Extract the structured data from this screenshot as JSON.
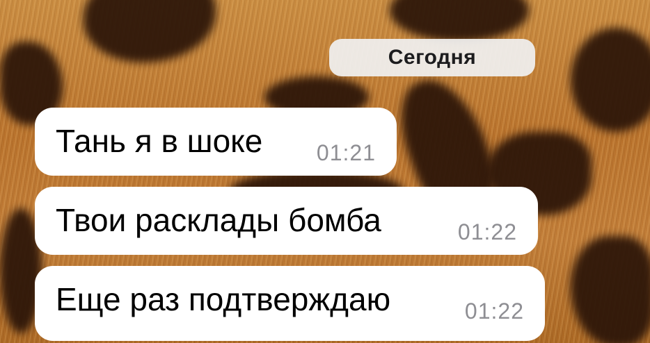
{
  "chat": {
    "date_separator": "Сегодня",
    "messages": [
      {
        "text": "Тань я в шоке",
        "time": "01:21"
      },
      {
        "text": "Твои расклады бомба",
        "time": "01:22"
      },
      {
        "text": "Еще раз подтверждаю",
        "time": "01:22"
      }
    ]
  },
  "theme": {
    "bubble_color": "#ffffff",
    "time_color": "#8e8e93",
    "date_pill_color": "#f0f0f0",
    "wallpaper": "leopard-fur"
  }
}
